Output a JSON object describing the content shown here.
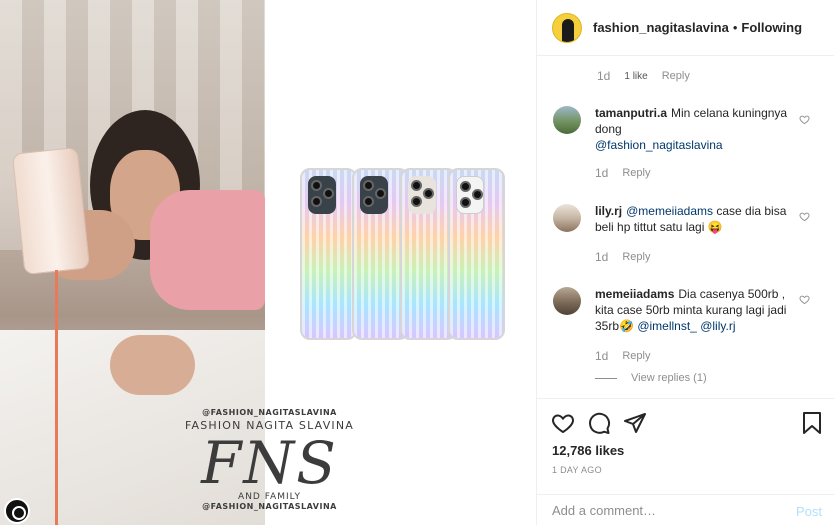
{
  "header": {
    "username": "fashion_nagitaslavina",
    "separator": "•",
    "follow_state": "Following"
  },
  "first_meta": {
    "time": "1d",
    "likes": "1 like",
    "reply": "Reply"
  },
  "comments": [
    {
      "username": "tamanputri.a",
      "text": "Min celana kuningnya dong",
      "mention": "@fashion_nagitaslavina",
      "time": "1d",
      "reply": "Reply"
    },
    {
      "username": "lily.rj",
      "mention": "@memeiiadams",
      "text": "case dia bisa beli hp tittut satu lagi",
      "emoji": "😝",
      "time": "1d",
      "reply": "Reply"
    },
    {
      "username": "memeiiadams",
      "text": "Dia casenya 500rb , kita case 50rb minta kurang lagi jadi 35rb",
      "emoji": "🤣",
      "mention1": "@imellnst_",
      "mention2": "@lily.rj",
      "time": "1d",
      "reply": "Reply",
      "view_replies": "View replies (1)"
    }
  ],
  "actions": {
    "likes": "12,786 likes",
    "time_ago": "1 DAY AGO",
    "comment_placeholder": "Add a comment…",
    "post_label": "Post"
  },
  "watermark": {
    "handle_top": "@FASHION_NAGITASLAVINA",
    "brand": "FASHION NAGITA SLAVINA",
    "mono": "FNS",
    "family": "AND FAMILY",
    "handle_bottom": "@FASHION_NAGITASLAVINA"
  },
  "icons": {
    "like": "heart-icon",
    "comment": "comment-bubble-icon",
    "share": "paper-plane-icon",
    "save": "bookmark-icon",
    "comment_like": "small-heart-icon"
  },
  "colors": {
    "mention": "#00376b",
    "muted": "#8e8e8e",
    "post_disabled": "#b2dffc",
    "border": "#efefef"
  }
}
